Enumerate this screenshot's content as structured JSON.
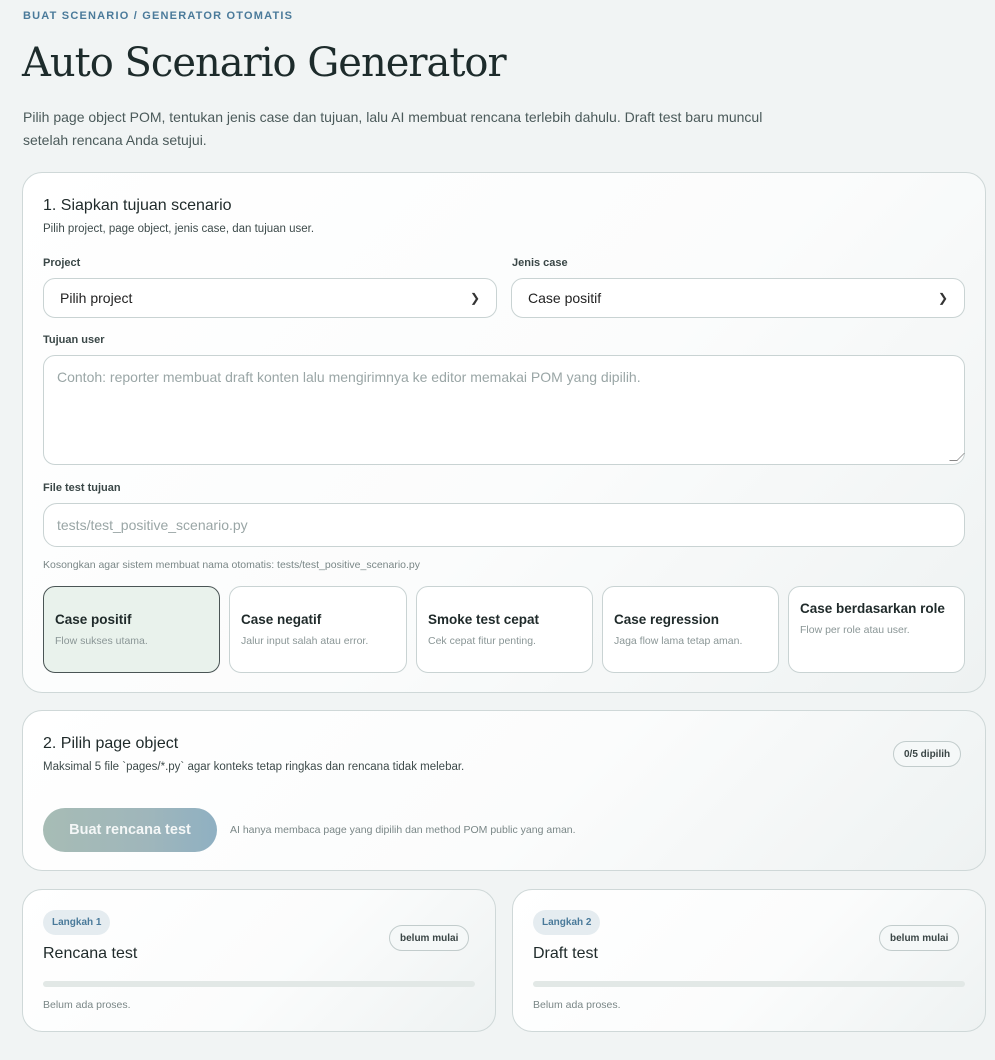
{
  "header": {
    "breadcrumb": "BUAT SCENARIO / GENERATOR OTOMATIS",
    "title": "Auto Scenario Generator",
    "description": "Pilih page object POM, tentukan jenis case dan tujuan, lalu AI membuat rencana terlebih dahulu. Draft test baru muncul setelah rencana Anda setujui."
  },
  "section1": {
    "title": "1. Siapkan tujuan scenario",
    "subtitle": "Pilih project, page object, jenis case, dan tujuan user.",
    "project_label": "Project",
    "project_value": "Pilih project",
    "case_type_label": "Jenis case",
    "case_type_value": "Case positif",
    "goal_label": "Tujuan user",
    "goal_placeholder": "Contoh: reporter membuat draft konten lalu mengirimnya ke editor memakai POM yang dipilih.",
    "file_label": "File test tujuan",
    "file_placeholder": "tests/test_positive_scenario.py",
    "file_hint": "Kosongkan agar sistem membuat nama otomatis: tests/test_positive_scenario.py",
    "case_options": [
      {
        "title": "Case positif",
        "subtitle": "Flow sukses utama.",
        "selected": true
      },
      {
        "title": "Case negatif",
        "subtitle": "Jalur input salah atau error.",
        "selected": false
      },
      {
        "title": "Smoke test cepat",
        "subtitle": "Cek cepat fitur penting.",
        "selected": false
      },
      {
        "title": "Case regression",
        "subtitle": "Jaga flow lama tetap aman.",
        "selected": false
      },
      {
        "title": "Case berdasarkan role",
        "subtitle": "Flow per role atau user.",
        "selected": false
      }
    ]
  },
  "section2": {
    "title": "2. Pilih page object",
    "subtitle": "Maksimal 5 file `pages/*.py` agar konteks tetap ringkas dan rencana tidak melebar.",
    "count_badge": "0/5 dipilih",
    "generate_button": "Buat rencana test",
    "generate_hint": "AI hanya membaca page yang dipilih dan method POM public yang aman."
  },
  "steps": [
    {
      "pill": "Langkah 1",
      "title": "Rencana test",
      "status_badge": "belum mulai",
      "status_text": "Belum ada proses.",
      "progress": 0
    },
    {
      "pill": "Langkah 2",
      "title": "Draft test",
      "status_badge": "belum mulai",
      "status_text": "Belum ada proses.",
      "progress": 0
    }
  ],
  "icons": {
    "select_chevron": "chevron-down-icon",
    "textarea_resize": "resize-grip-icon"
  },
  "colors": {
    "accent_blue": "#4a7a9a",
    "selected_case_bg": "#e9f2ec",
    "page_bg": "#f1f4f4"
  }
}
